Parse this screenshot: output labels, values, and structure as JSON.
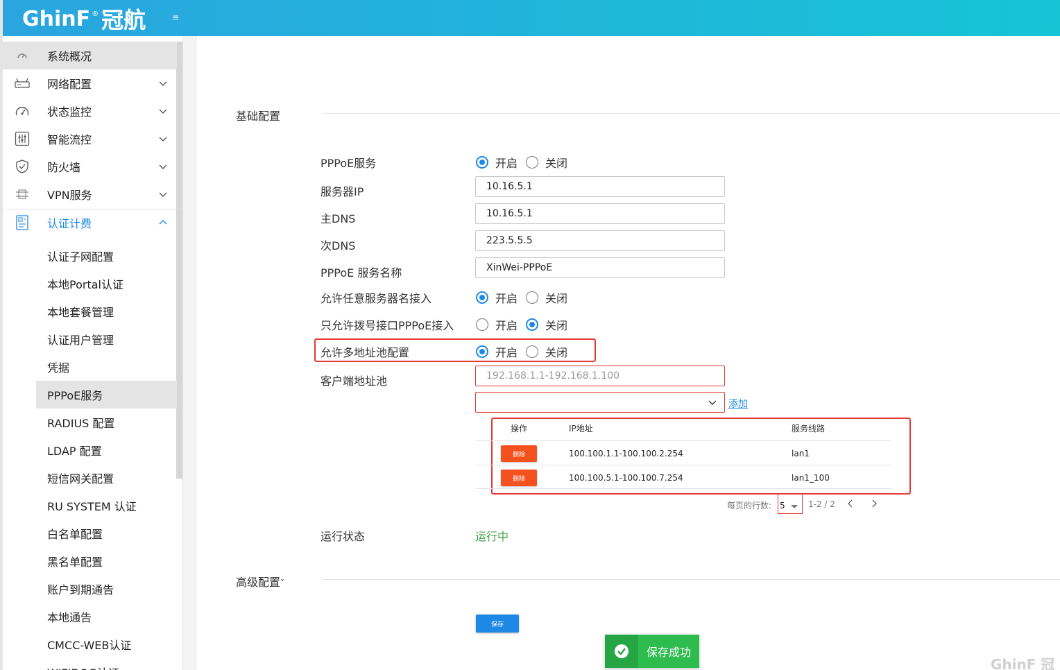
{
  "header": {
    "logo_text": "GhinF",
    "logo_reg": "®",
    "logo_cn": "冠航",
    "menu_toggle": "≡"
  },
  "sidebar": {
    "top_items": [
      {
        "label": "系统概况",
        "icon": "dashboard-icon"
      },
      {
        "label": "网络配置",
        "icon": "router-icon"
      },
      {
        "label": "状态监控",
        "icon": "gauge-icon"
      },
      {
        "label": "智能流控",
        "icon": "sliders-icon"
      },
      {
        "label": "防火墙",
        "icon": "shield-icon"
      },
      {
        "label": "VPN服务",
        "icon": "vpn-icon"
      },
      {
        "label": "认证计费",
        "icon": "auth-billing-icon"
      }
    ],
    "sub_items": [
      "认证子网配置",
      "本地Portal认证",
      "本地套餐管理",
      "认证用户管理",
      "凭据",
      "PPPoE服务",
      "RADIUS 配置",
      "LDAP 配置",
      "短信网关配置",
      "RU SYSTEM 认证",
      "白名单配置",
      "黑名单配置",
      "账户到期通告",
      "本地通告",
      "CMCC-WEB认证",
      "WIFIDOG认证"
    ],
    "active_sub": "PPPoE服务"
  },
  "main": {
    "basic_section": "基础配置",
    "advanced_section": "高级配置",
    "advanced_chevron": "˅",
    "on_label": "开启",
    "off_label": "关闭",
    "fields": {
      "pppoe_service": {
        "label": "PPPoE服务",
        "value": "开启"
      },
      "server_ip": {
        "label": "服务器IP",
        "value": "10.16.5.1"
      },
      "primary_dns": {
        "label": "主DNS",
        "value": "10.16.5.1"
      },
      "secondary_dns": {
        "label": "次DNS",
        "value": "223.5.5.5"
      },
      "service_name": {
        "label": "PPPoE 服务名称",
        "value": "XinWei-PPPoE"
      },
      "allow_any_server_name": {
        "label": "允许任意服务器名接入",
        "value": "开启"
      },
      "dial_iface_only": {
        "label": "只允许拨号接口PPPoE接入",
        "value": "关闭"
      },
      "multi_pool": {
        "label": "允许多地址池配置",
        "value": "开启"
      },
      "client_pool": {
        "label": "客户端地址池",
        "placeholder": "192.168.1.1-192.168.1.100",
        "value": ""
      },
      "run_status": {
        "label": "运行状态",
        "value": "运行中"
      }
    },
    "add_link": "添加",
    "table": {
      "headers": [
        "操作",
        "IP地址",
        "服务线路"
      ],
      "rows": [
        {
          "action": "删除",
          "ip": "100.100.1.1-100.100.2.254",
          "line": "lan1"
        },
        {
          "action": "删除",
          "ip": "100.100.5.1-100.100.7.254",
          "line": "lan1_100"
        }
      ]
    },
    "pager": {
      "rows_per_page_label": "每页的行数:",
      "rows_per_page": "5",
      "range": "1-2 / 2"
    },
    "save_button": "保存",
    "toast": "保存成功"
  },
  "watermark": "GhinF 冠航",
  "colors": {
    "header_start": "#2aa5df",
    "header_end": "#17c4d6",
    "accent": "#1e88e5",
    "danger": "#f4511e",
    "success": "#2ebc4f",
    "highlight_border": "#e53935"
  }
}
